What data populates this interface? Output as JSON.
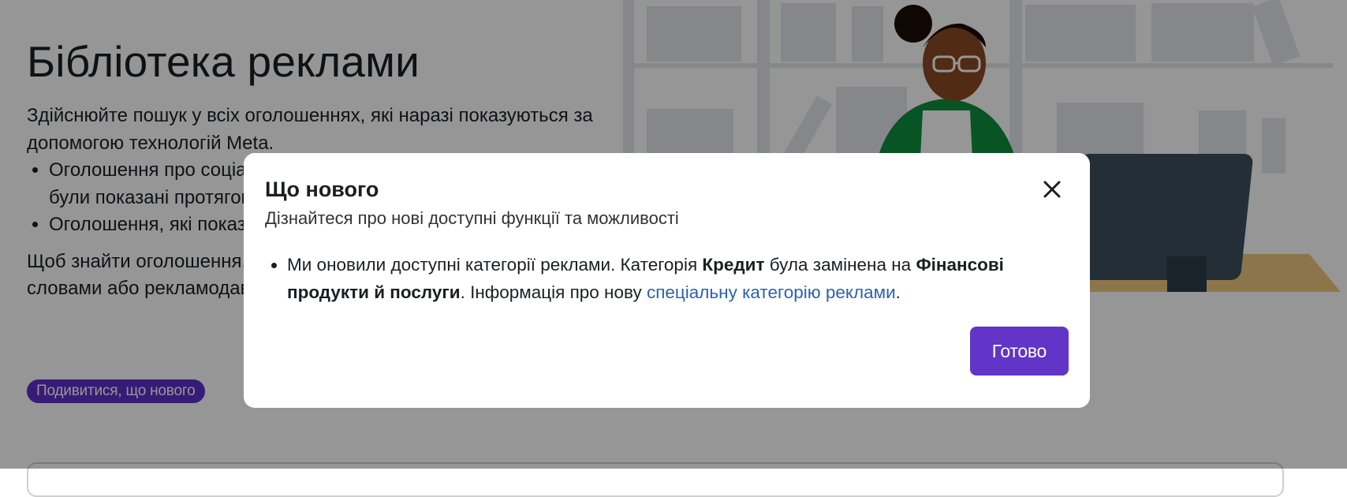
{
  "hero": {
    "title": "Бібліотека реклами",
    "intro": "Здійснюйте пошук у всіх оголошеннях, які наразі показуються за допомогою технологій Meta.",
    "bullets": [
      "Оголошення про соціальні питання, вибори чи політику, які були показані протягом останніх семи років",
      "Оголошення, які показувалися в ЄС протягом минулого року"
    ],
    "search_hint": "Щоб знайти оголошення, скористайтеся пошуком за ключовими словами або рекламодавцем.",
    "whats_new_label": "Подивитися, що нового"
  },
  "modal": {
    "title": "Що нового",
    "subtitle": "Дізнайтеся про нові доступні функції та можливості",
    "item": {
      "part1": "Ми оновили доступні категорії реклами. Категорія ",
      "bold1": "Кредит",
      "part2": " була замінена на ",
      "bold2": "Фінансові продукти й послуги",
      "part3": ". Інформація про нову ",
      "link": "спеціальну категорію реклами",
      "part4": "."
    },
    "done_label": "Готово"
  },
  "colors": {
    "accent": "#6234c8",
    "link": "#2a62b0",
    "overlay": "rgba(0,0,0,0.41)"
  },
  "icons": {
    "close": "close-icon"
  }
}
